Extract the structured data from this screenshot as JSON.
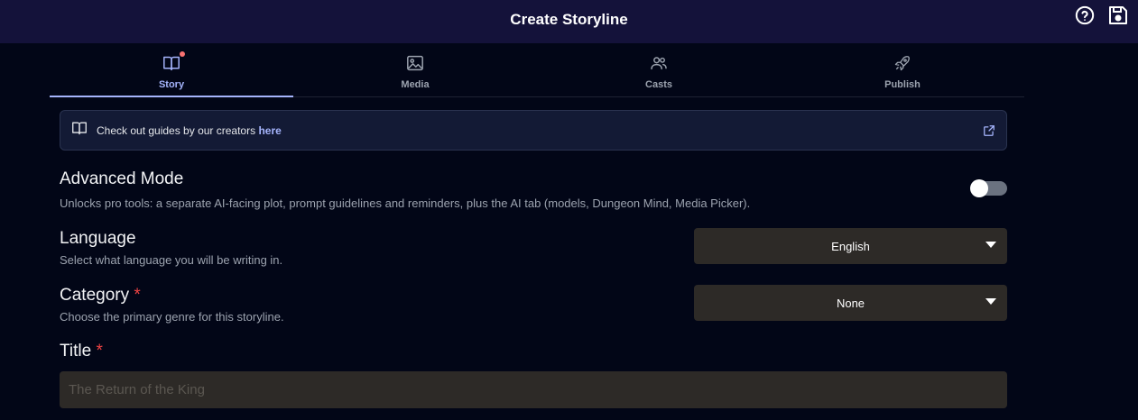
{
  "header": {
    "title": "Create Storyline"
  },
  "tabs": [
    {
      "label": "Story",
      "icon": "book-icon",
      "active": true
    },
    {
      "label": "Media",
      "icon": "image-icon",
      "active": false
    },
    {
      "label": "Casts",
      "icon": "users-icon",
      "active": false
    },
    {
      "label": "Publish",
      "icon": "rocket-icon",
      "active": false
    }
  ],
  "guide": {
    "text": "Check out guides by our creators ",
    "link": "here"
  },
  "advanced": {
    "title": "Advanced Mode",
    "description": "Unlocks pro tools: a separate AI-facing plot, prompt guidelines and reminders, plus the AI tab (models, Dungeon Mind, Media Picker).",
    "enabled": false
  },
  "language": {
    "title": "Language",
    "description": "Select what language you will be writing in.",
    "value": "English"
  },
  "category": {
    "title": "Category",
    "required_mark": "*",
    "description": "Choose the primary genre for this storyline.",
    "value": "None"
  },
  "title_field": {
    "label": "Title",
    "required_mark": "*",
    "placeholder": "The Return of the King"
  },
  "colors": {
    "accent": "#a5b4fc",
    "header_bg": "#14123a",
    "page_bg": "#020617",
    "field_bg": "#2d2a27",
    "required": "#ef4444"
  }
}
